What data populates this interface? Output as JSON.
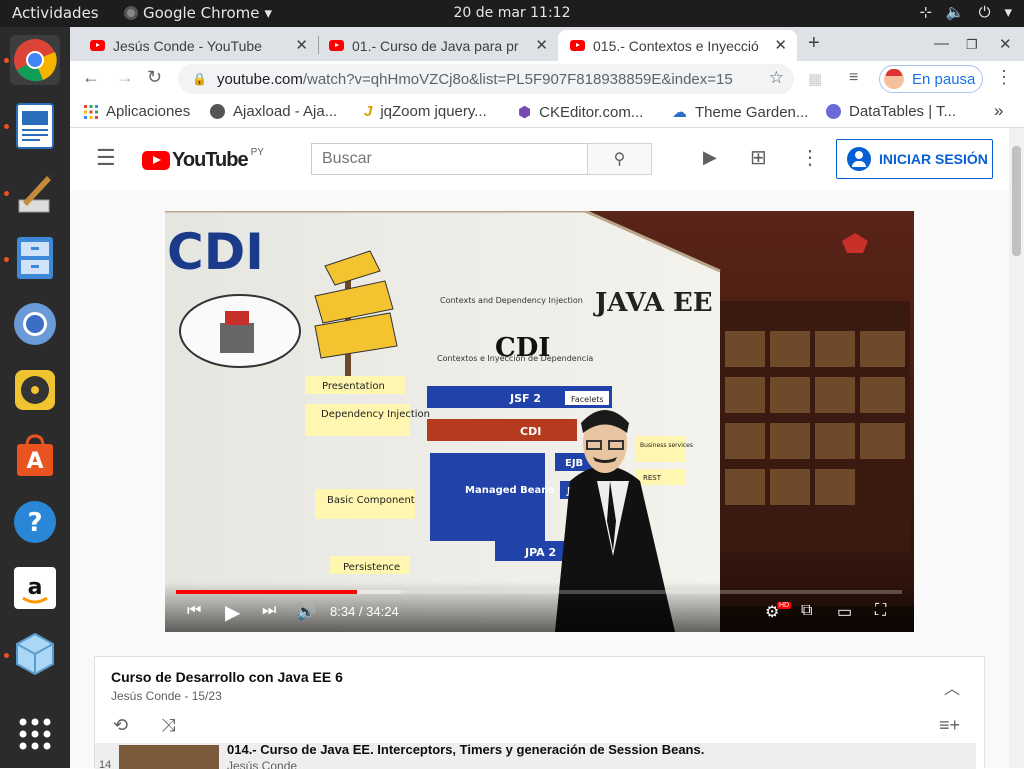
{
  "system": {
    "activities": "Actividades",
    "app_name": "Google Chrome",
    "clock": "20 de mar  11:12",
    "dock": [
      "chrome-icon",
      "document-viewer-icon",
      "paint-icon",
      "file-cabinet-icon",
      "chromium-icon",
      "rhythmbox-icon",
      "software-store-icon",
      "help-icon",
      "amazon-icon",
      "box-app-icon",
      "show-apps-icon"
    ]
  },
  "tabs": [
    {
      "title": "Jesús Conde - YouTube"
    },
    {
      "title": "01.- Curso de Java para pr"
    },
    {
      "title": "015.- Contextos e Inyecció"
    }
  ],
  "toolbar": {
    "url_host": "youtube.com",
    "url_path": "/watch?v=qhHmoVZCj8o&list=PL5F907F818938859E&index=15",
    "profile_status": "En pausa"
  },
  "bookmarks": [
    {
      "label": "Aplicaciones"
    },
    {
      "label": "Ajaxload - Aja..."
    },
    {
      "label": "jqZoom jquery..."
    },
    {
      "label": "CKEditor.com..."
    },
    {
      "label": "Theme Garden..."
    },
    {
      "label": "DataTables | T..."
    }
  ],
  "youtube": {
    "logo_text": "YouTube",
    "country": "PY",
    "search_placeholder": "Buscar",
    "signin": "INICIAR SESIÓN"
  },
  "player": {
    "slide_title": "CDI",
    "time": "8:34 / 34:24",
    "progress": 0.249,
    "buffered": 0.31,
    "hd": "HD",
    "slide": {
      "brand": "JAVA EE",
      "cdi_top": "Contexts and Dependency Injection",
      "cdi_bottom": "Contextos e Inyección de Dependencia",
      "labels": [
        "Presentation",
        "Dependency Injection",
        "Basic Component",
        "Persistence"
      ],
      "jsf": "JSF 2",
      "facelets": "Facelets",
      "cdi": "CDI",
      "managed": "Managed Beans",
      "ejb": "EJB",
      "ja": "JA",
      "jpa": "JPA 2",
      "business": "Business services",
      "rest": "REST"
    }
  },
  "playlist": {
    "title": "Curso de Desarrollo con Java EE 6",
    "owner": "Jesús Conde - 15/23",
    "item": {
      "num": "14",
      "title": "014.- Curso de Java EE. Interceptors, Timers y generación de Session Beans.",
      "author": "Jesús Conde"
    }
  }
}
